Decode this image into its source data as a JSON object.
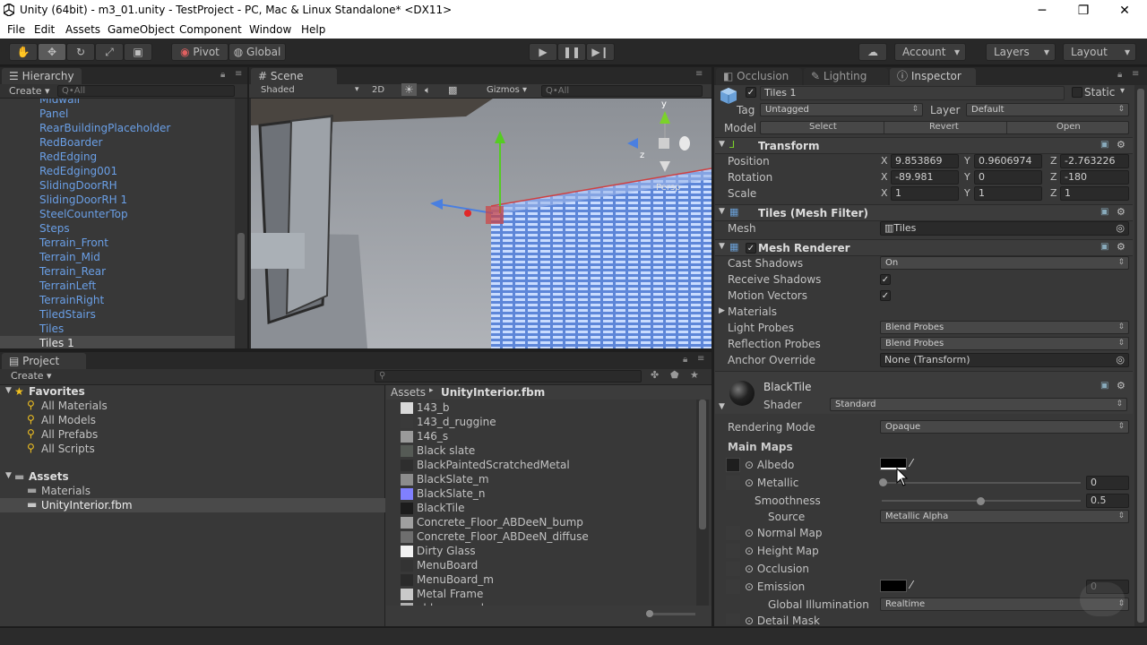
{
  "window": {
    "title": "Unity (64bit) - m3_01.unity - TestProject - PC, Mac & Linux Standalone* <DX11>",
    "minimize": "─",
    "maximize": "❐",
    "close": "✕"
  },
  "menu": [
    "File",
    "Edit",
    "Assets",
    "GameObject",
    "Component",
    "Window",
    "Help"
  ],
  "toolbar": {
    "pivot": "Pivot",
    "global": "Global",
    "account": "Account",
    "layers": "Layers",
    "layout": "Layout"
  },
  "hierarchy": {
    "tab": "Hierarchy",
    "create": "Create",
    "search_placeholder": "Q•All",
    "items": [
      "Midwall",
      "Panel",
      "RearBuildingPlaceholder",
      "RedBoarder",
      "RedEdging",
      "RedEdging001",
      "SlidingDoorRH",
      "SlidingDoorRH 1",
      "SteelCounterTop",
      "Steps",
      "Terrain_Front",
      "Terrain_Mid",
      "Terrain_Rear",
      "TerrainLeft",
      "TerrainRight",
      "TiledStairs",
      "Tiles",
      "Tiles 1"
    ]
  },
  "scene": {
    "tab": "Scene",
    "shaded": "Shaded",
    "mode2d": "2D",
    "gizmos": "Gizmos",
    "search_placeholder": "Q•All",
    "persp": "Persp",
    "axis_z": "z",
    "axis_y": "y"
  },
  "project": {
    "tab": "Project",
    "create": "Create",
    "favorites_label": "Favorites",
    "favorites": [
      "All Materials",
      "All Models",
      "All Prefabs",
      "All Scripts"
    ],
    "assets_label": "Assets",
    "folders": [
      "Materials",
      "UnityInterior.fbm"
    ],
    "breadcrumb_root": "Assets",
    "breadcrumb_sep": "▸",
    "breadcrumb_current": "UnityInterior.fbm",
    "files": [
      {
        "name": "143_b",
        "color": "#d9d9d9"
      },
      {
        "name": "143_d_ruggine",
        "color": "#3a3a3a"
      },
      {
        "name": "146_s",
        "color": "#9a9a9a"
      },
      {
        "name": "Black slate",
        "color": "#555a55"
      },
      {
        "name": "BlackPaintedScratchedMetal",
        "color": "#2e2e2e"
      },
      {
        "name": "BlackSlate_m",
        "color": "#8c8c8c"
      },
      {
        "name": "BlackSlate_n",
        "color": "#8080ff"
      },
      {
        "name": "BlackTile",
        "color": "#1c1c1c"
      },
      {
        "name": "Concrete_Floor_ABDeeN_bump",
        "color": "#a0a0a0"
      },
      {
        "name": "Concrete_Floor_ABDeeN_diffuse",
        "color": "#6e6e6e"
      },
      {
        "name": "Dirty Glass",
        "color": "#f2f2f2"
      },
      {
        "name": "MenuBoard",
        "color": "#333333"
      },
      {
        "name": "MenuBoard_m",
        "color": "#2a2a2a"
      },
      {
        "name": "Metal Frame",
        "color": "#c9c9c9"
      },
      {
        "name": "old_copper_bump",
        "color": "#b0b0b0"
      }
    ]
  },
  "inspector": {
    "tabs": [
      "Occlusion",
      "Lighting",
      "Inspector"
    ],
    "object_name": "Tiles 1",
    "static_label": "Static",
    "tag_label": "Tag",
    "tag_value": "Untagged",
    "layer_label": "Layer",
    "layer_value": "Default",
    "model_label": "Model",
    "model_select": "Select",
    "model_revert": "Revert",
    "model_open": "Open",
    "transform": {
      "title": "Transform",
      "position_label": "Position",
      "position": [
        "9.853869",
        "0.9606974",
        "-2.763226"
      ],
      "rotation_label": "Rotation",
      "rotation": [
        "-89.981",
        "0",
        "-180"
      ],
      "scale_label": "Scale",
      "scale": [
        "1",
        "1",
        "1"
      ],
      "x": "X",
      "y": "Y",
      "z": "Z"
    },
    "mesh_filter": {
      "title": "Tiles (Mesh Filter)",
      "mesh_label": "Mesh",
      "mesh_value": "Tiles"
    },
    "mesh_renderer": {
      "title": "Mesh Renderer",
      "cast_shadows_label": "Cast Shadows",
      "cast_shadows": "On",
      "receive_shadows_label": "Receive Shadows",
      "motion_vectors_label": "Motion Vectors",
      "materials_label": "Materials",
      "light_probes_label": "Light Probes",
      "light_probes": "Blend Probes",
      "reflection_probes_label": "Reflection Probes",
      "reflection_probes": "Blend Probes",
      "anchor_override_label": "Anchor Override",
      "anchor_override": "None (Transform)"
    },
    "material": {
      "name": "BlackTile",
      "shader_label": "Shader",
      "shader": "Standard",
      "rendering_mode_label": "Rendering Mode",
      "rendering_mode": "Opaque",
      "main_maps": "Main Maps",
      "albedo": "Albedo",
      "metallic": "Metallic",
      "metallic_value": "0",
      "smoothness": "Smoothness",
      "smoothness_value": "0.5",
      "source": "Source",
      "source_value": "Metallic Alpha",
      "normal_map": "Normal Map",
      "height_map": "Height Map",
      "occlusion": "Occlusion",
      "emission": "Emission",
      "emission_value": "0",
      "global_illumination": "Global Illumination",
      "gi_value": "Realtime",
      "detail_mask": "Detail Mask"
    }
  }
}
